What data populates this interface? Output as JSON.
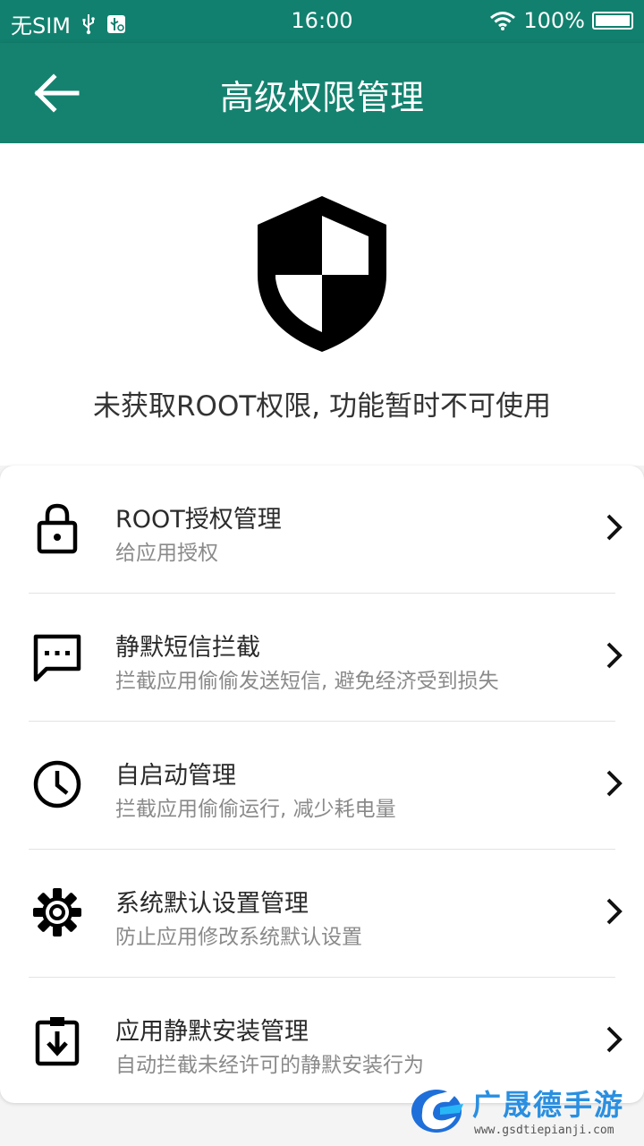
{
  "status_bar": {
    "carrier": "无SIM",
    "time": "16:00",
    "battery_percent": "100%"
  },
  "app_bar": {
    "title": "高级权限管理",
    "back_icon": "arrow-left-icon"
  },
  "hero": {
    "icon": "shield-icon",
    "message": "未获取ROOT权限, 功能暂时不可使用"
  },
  "items": [
    {
      "icon": "lock-icon",
      "title": "ROOT授权管理",
      "subtitle": "给应用授权"
    },
    {
      "icon": "message-icon",
      "title": "静默短信拦截",
      "subtitle": "拦截应用偷偷发送短信, 避免经济受到损失"
    },
    {
      "icon": "clock-icon",
      "title": "自启动管理",
      "subtitle": "拦截应用偷偷运行, 减少耗电量"
    },
    {
      "icon": "gear-icon",
      "title": "系统默认设置管理",
      "subtitle": "防止应用修改系统默认设置"
    },
    {
      "icon": "install-icon",
      "title": "应用静默安装管理",
      "subtitle": "自动拦截未经许可的静默安装行为"
    }
  ],
  "watermark": {
    "brand": "广晟德手游",
    "url": "www.gsdtiepianji.com"
  },
  "colors": {
    "primary": "#15826f",
    "status_bar": "#12806e",
    "title_text": "#2a2a2a",
    "subtitle_text": "#8a8a8a"
  }
}
